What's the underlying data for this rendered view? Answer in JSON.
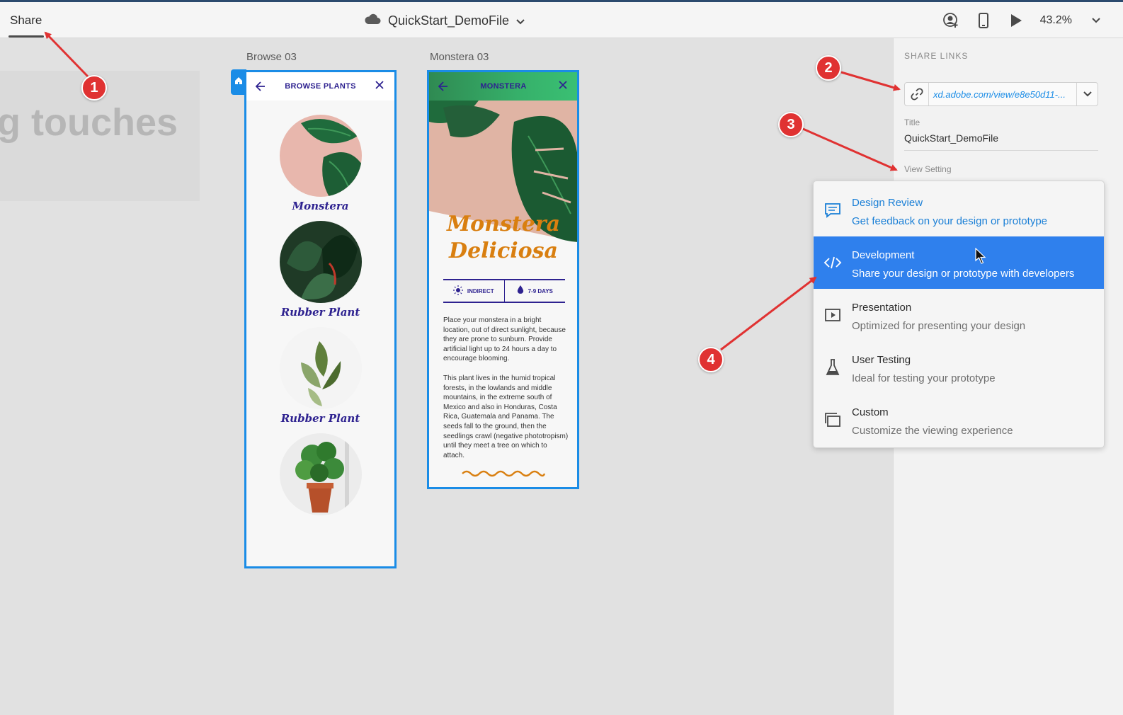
{
  "topbar": {
    "share_tab": "Share",
    "doc_title": "QuickStart_DemoFile",
    "zoom": "43.2%"
  },
  "canvas": {
    "ghost_text": "g touches"
  },
  "artboards": {
    "browse": {
      "label": "Browse 03",
      "header": "BROWSE PLANTS",
      "plants": [
        "Monstera",
        "Rubber Plant",
        "Rubber Plant"
      ]
    },
    "monstera": {
      "label": "Monstera 03",
      "header": "MONSTERA",
      "title_line1": "Monstera",
      "title_line2": "Deliciosa",
      "stat_light": "INDIRECT",
      "stat_water": "7-9 DAYS",
      "para1": "Place your monstera in a bright location, out of direct sunlight, because they are prone to sunburn. Provide artificial light up to 24 hours a day to encourage blooming.",
      "para2": "This plant lives in the humid tropical forests, in the lowlands and middle mountains, in the extreme south of Mexico and also in Honduras, Costa Rica, Guatemala and Panama. The seeds fall to the ground, then the seedlings crawl (negative phototropism) until they meet a tree on which to attach."
    }
  },
  "panel": {
    "heading": "SHARE LINKS",
    "link_url": "xd.adobe.com/view/e8e50d11-...",
    "title_label": "Title",
    "title_value": "QuickStart_DemoFile",
    "view_setting_label": "View Setting"
  },
  "dropdown": {
    "selected_index": 1,
    "items": [
      {
        "title": "Design Review",
        "subtitle": "Get feedback on your design or prototype",
        "icon": "comment-icon"
      },
      {
        "title": "Development",
        "subtitle": "Share your design or prototype with developers",
        "icon": "code-icon"
      },
      {
        "title": "Presentation",
        "subtitle": "Optimized for presenting your design",
        "icon": "play-screen-icon"
      },
      {
        "title": "User Testing",
        "subtitle": "Ideal for testing your prototype",
        "icon": "flask-icon"
      },
      {
        "title": "Custom",
        "subtitle": "Customize the viewing experience",
        "icon": "layers-icon"
      }
    ]
  },
  "markers": [
    "1",
    "2",
    "3",
    "4"
  ],
  "colors": {
    "accent": "#1a8ce6",
    "selected": "#2f80ed",
    "marker": "#e03232",
    "plant_text": "#2e2290",
    "title_orange": "#d97f10"
  }
}
